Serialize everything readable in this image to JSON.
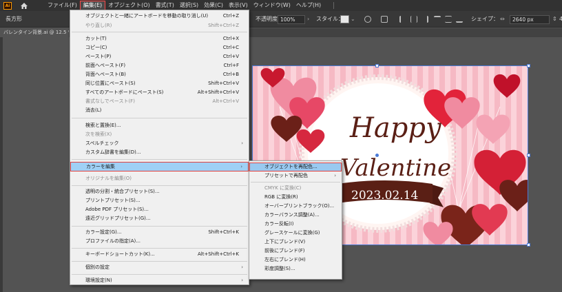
{
  "menubar": {
    "logo": "Ai",
    "items": [
      "ファイル(F)",
      "編集(E)",
      "オブジェクト(O)",
      "書式(T)",
      "選択(S)",
      "効果(C)",
      "表示(V)",
      "ウィンドウ(W)",
      "ヘルプ(H)"
    ]
  },
  "controlbar": {
    "shape_label": "長方形",
    "opacity_label": "不透明度：",
    "opacity_value": "100%",
    "style_label": "スタイル：",
    "shape_label2": "シェイプ：",
    "width_value": "2640 px",
    "extra": "4"
  },
  "tab": {
    "title": "バレンタイン背景.ai @ 12.5 %"
  },
  "edit_menu": {
    "items": [
      {
        "label": "オブジェクトと一緒にアートボードを移動の取り消し(U)",
        "shortcut": "Ctrl+Z",
        "disabled": false
      },
      {
        "label": "やり直し(R)",
        "shortcut": "Shift+Ctrl+Z",
        "disabled": true
      },
      {
        "label": "カット(T)",
        "shortcut": "Ctrl+X",
        "disabled": false
      },
      {
        "label": "コピー(C)",
        "shortcut": "Ctrl+C",
        "disabled": false
      },
      {
        "label": "ペースト(P)",
        "shortcut": "Ctrl+V",
        "disabled": false
      },
      {
        "label": "前面へペースト(F)",
        "shortcut": "Ctrl+F",
        "disabled": false
      },
      {
        "label": "背面へペースト(B)",
        "shortcut": "Ctrl+B",
        "disabled": false
      },
      {
        "label": "同じ位置にペースト(S)",
        "shortcut": "Shift+Ctrl+V",
        "disabled": false
      },
      {
        "label": "すべてのアートボードにペースト(S)",
        "shortcut": "Alt+Shift+Ctrl+V",
        "disabled": false
      },
      {
        "label": "書式なしでペースト(F)",
        "shortcut": "Alt+Ctrl+V",
        "disabled": true
      },
      {
        "label": "消去(L)",
        "shortcut": "",
        "disabled": false
      },
      {
        "label": "検索と置換(E)...",
        "shortcut": "",
        "disabled": false
      },
      {
        "label": "次を検索(X)",
        "shortcut": "",
        "disabled": true
      },
      {
        "label": "スペルチェック",
        "shortcut": "",
        "disabled": false,
        "submenu": true
      },
      {
        "label": "カスタム辞書を編集(D)...",
        "shortcut": "",
        "disabled": false
      },
      {
        "label": "カラーを編集",
        "shortcut": "",
        "disabled": false,
        "submenu": true,
        "highlighted": true
      },
      {
        "label": "オリジナルを編集(O)",
        "shortcut": "",
        "disabled": true
      },
      {
        "label": "透明の分割・統合プリセット(S)...",
        "shortcut": "",
        "disabled": false
      },
      {
        "label": "プリントプリセット(S)...",
        "shortcut": "",
        "disabled": false
      },
      {
        "label": "Adobe PDF プリセット(S)...",
        "shortcut": "",
        "disabled": false
      },
      {
        "label": "遠近グリッドプリセット(G)...",
        "shortcut": "",
        "disabled": false
      },
      {
        "label": "カラー設定(G)...",
        "shortcut": "Shift+Ctrl+K",
        "disabled": false
      },
      {
        "label": "プロファイルの指定(A)...",
        "shortcut": "",
        "disabled": false
      },
      {
        "label": "キーボードショートカット(K)...",
        "shortcut": "Alt+Shift+Ctrl+K",
        "disabled": false
      },
      {
        "label": "個別の設定",
        "shortcut": "",
        "disabled": false,
        "submenu": true
      },
      {
        "label": "環境設定(N)",
        "shortcut": "",
        "disabled": false,
        "submenu": true
      }
    ]
  },
  "color_submenu": {
    "items": [
      {
        "label": "オブジェクトを再配色...",
        "disabled": false,
        "highlighted": true
      },
      {
        "label": "プリセットで再配色",
        "disabled": false,
        "submenu": true
      },
      {
        "label": "CMYK に変換(C)",
        "disabled": true
      },
      {
        "label": "RGB に変換(R)",
        "disabled": false
      },
      {
        "label": "オーバープリントブラック(O)...",
        "disabled": false
      },
      {
        "label": "カラーバランス調整(A)...",
        "disabled": false
      },
      {
        "label": "カラー反転(I)",
        "disabled": false
      },
      {
        "label": "グレースケールに変換(G)",
        "disabled": false
      },
      {
        "label": "上下にブレンド(V)",
        "disabled": false
      },
      {
        "label": "前後にブレンド(F)",
        "disabled": false
      },
      {
        "label": "左右にブレンド(H)",
        "disabled": false
      },
      {
        "label": "彩度調整(S)...",
        "disabled": false
      }
    ]
  },
  "artboard": {
    "title_line1": "Happy",
    "title_line2": "Valentine",
    "date": "2023.02.14"
  }
}
